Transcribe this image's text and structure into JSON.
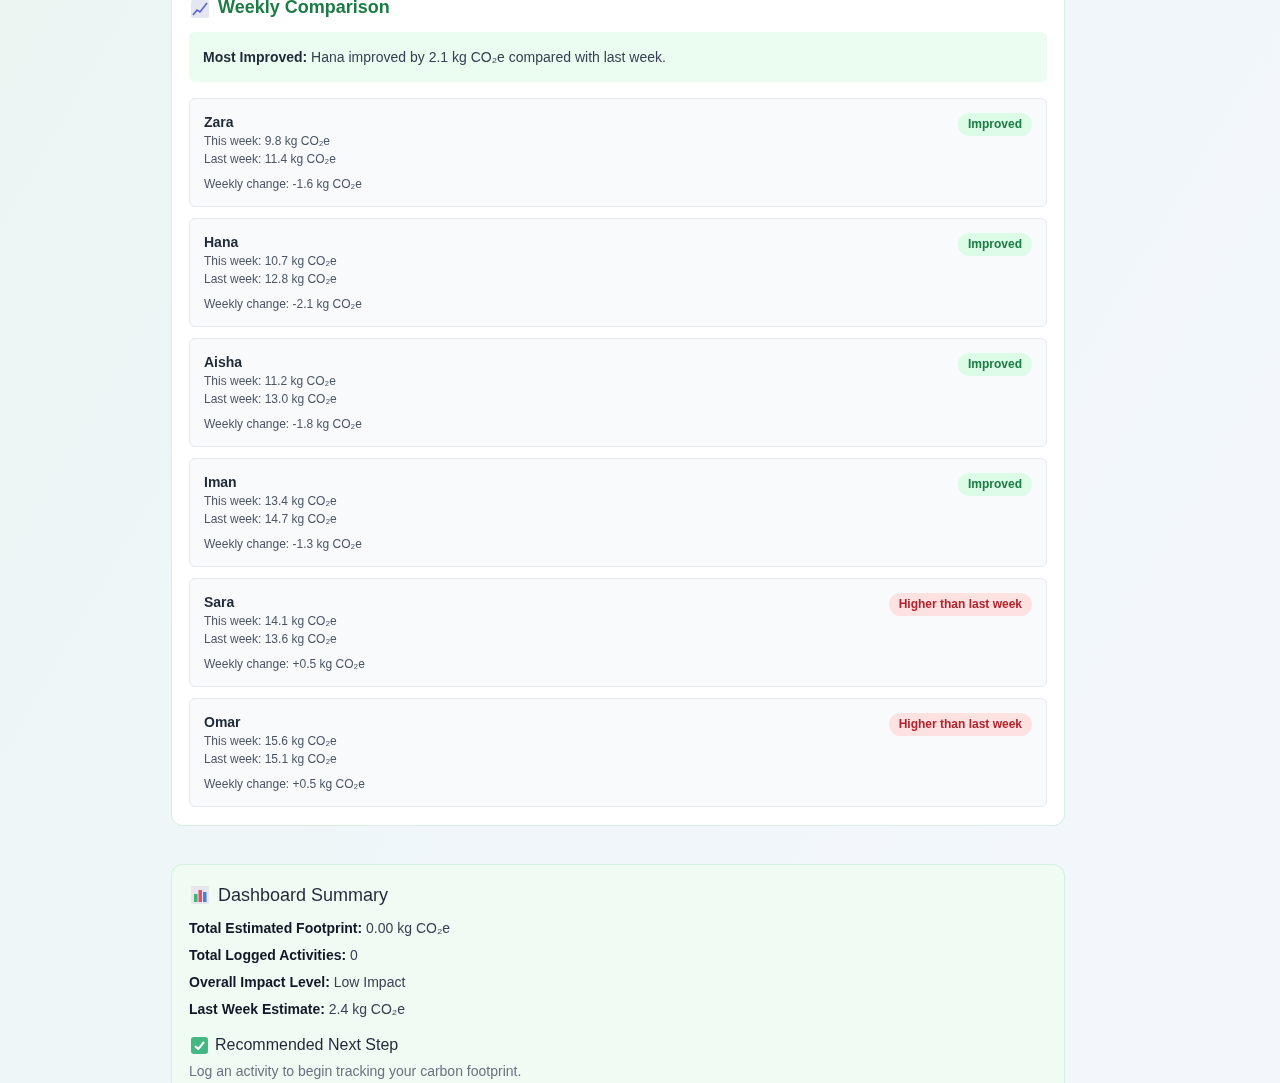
{
  "weekly_comparison": {
    "title": "Weekly Comparison",
    "most_improved": "**Most Improved:** Hana improved by 2.1 kg CO₂e compared with last week.",
    "members": [
      {
        "name": "Zara",
        "this_week": "This week: 9.8 kg CO₂e",
        "last_week": "Last week: 11.4 kg CO₂e",
        "weekly_change": "Weekly change: -1.6 kg CO₂e",
        "status": {
          "kind": "improved",
          "label": "Improved"
        }
      },
      {
        "name": "Hana",
        "this_week": "This week: 10.7 kg CO₂e",
        "last_week": "Last week: 12.8 kg CO₂e",
        "weekly_change": "Weekly change: -2.1 kg CO₂e",
        "status": {
          "kind": "improved",
          "label": "Improved"
        }
      },
      {
        "name": "Aisha",
        "this_week": "This week: 11.2 kg CO₂e",
        "last_week": "Last week: 13.0 kg CO₂e",
        "weekly_change": "Weekly change: -1.8 kg CO₂e",
        "status": {
          "kind": "improved",
          "label": "Improved"
        }
      },
      {
        "name": "Iman",
        "this_week": "This week: 13.4 kg CO₂e",
        "last_week": "Last week: 14.7 kg CO₂e",
        "weekly_change": "Weekly change: -1.3 kg CO₂e",
        "status": {
          "kind": "improved",
          "label": "Improved"
        }
      },
      {
        "name": "Sara",
        "this_week": "This week: 14.1 kg CO₂e",
        "last_week": "Last week: 13.6 kg CO₂e",
        "weekly_change": "Weekly change: +0.5 kg CO₂e",
        "status": {
          "kind": "higher",
          "label": "Higher than last week"
        }
      },
      {
        "name": "Omar",
        "this_week": "This week: 15.6 kg CO₂e",
        "last_week": "Last week: 15.1 kg CO₂e",
        "weekly_change": "Weekly change: +0.5 kg CO₂e",
        "status": {
          "kind": "higher",
          "label": "Higher than last week"
        }
      }
    ]
  },
  "dashboard_summary": {
    "title": "Dashboard Summary",
    "stats": [
      "**Total Estimated Footprint:** 0.00 kg CO₂e",
      "**Total Logged Activities:** 0",
      "**Overall Impact Level:** Low Impact",
      "**Last Week Estimate:** 2.4 kg CO₂e"
    ],
    "next_step": {
      "title": "Recommended Next Step",
      "text": "Log an activity to begin tracking your carbon footprint."
    }
  }
}
